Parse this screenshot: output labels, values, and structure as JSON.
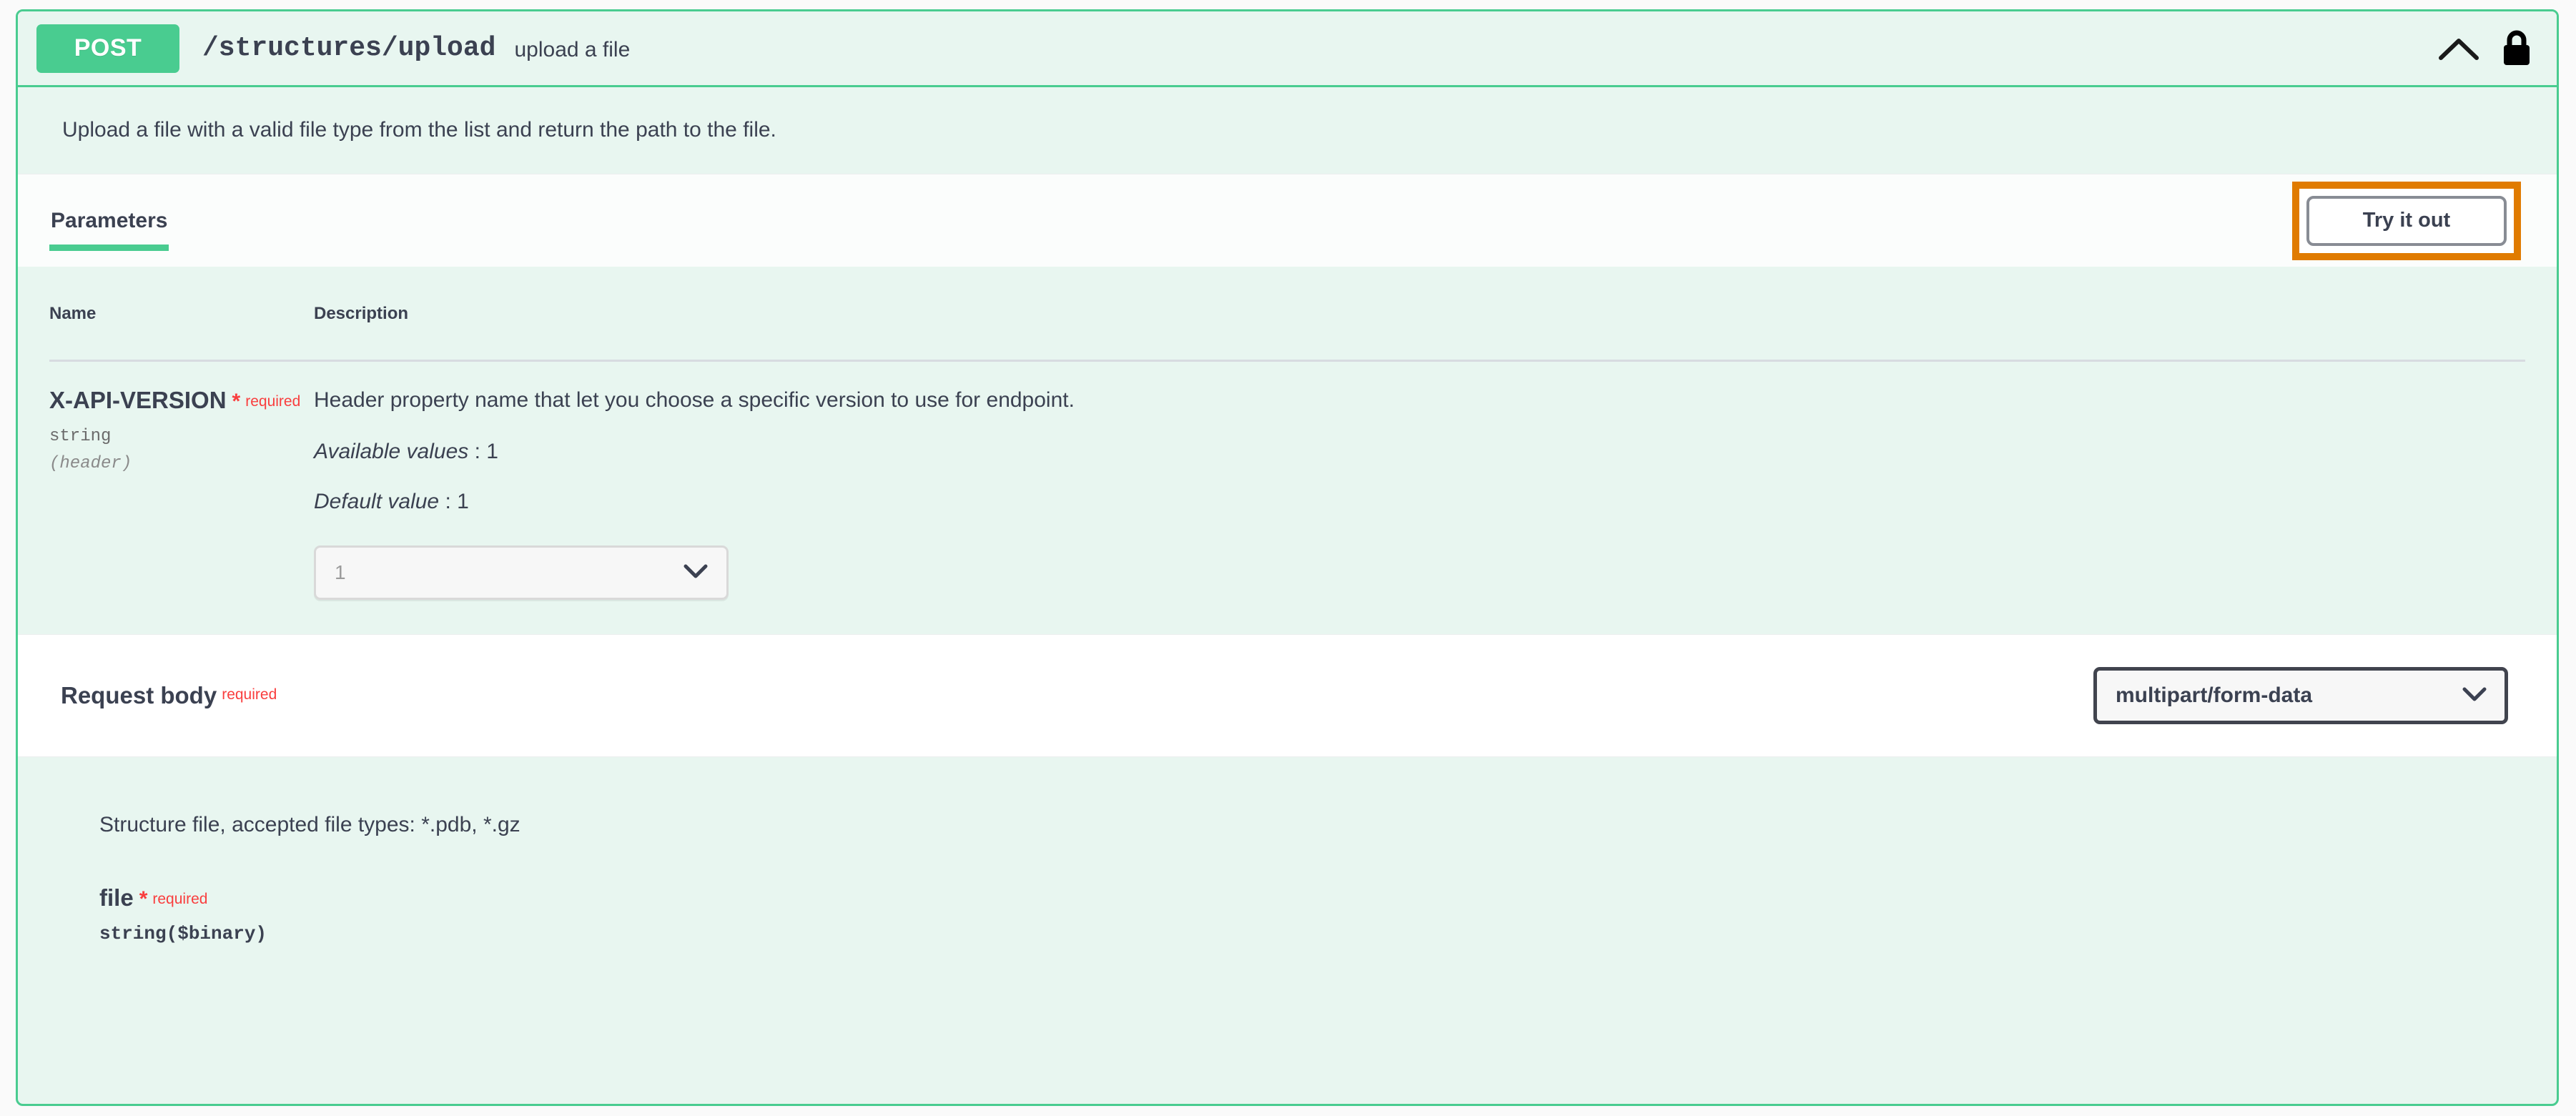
{
  "operation": {
    "method": "POST",
    "path": "/structures/upload",
    "summary": "upload a file",
    "description": "Upload a file with a valid file type from the list and return the path to the file.",
    "collapse_icon": "chevron-up-icon",
    "auth_icon": "lock-icon",
    "accent_color": "#49cc90",
    "required_color": "#f93e3e",
    "highlight_color": "#e07b00"
  },
  "tabs": [
    {
      "label": "Parameters",
      "active": true
    }
  ],
  "actions": {
    "try_it_out_label": "Try it out"
  },
  "parameters_table": {
    "headers": [
      "Name",
      "Description"
    ],
    "rows": [
      {
        "name": "X-API-VERSION",
        "required_star": "*",
        "required_text": "required",
        "type": "string",
        "location": "(header)",
        "description": "Header property name that let you choose a specific version to use for endpoint.",
        "meta": [
          {
            "label": "Available values",
            "separator": " : ",
            "value": "1"
          },
          {
            "label": "Default value",
            "separator": " : ",
            "value": "1"
          }
        ],
        "input": {
          "kind": "select",
          "value": "1",
          "disabled": true,
          "icon": "chevron-down-icon"
        }
      }
    ]
  },
  "request_body": {
    "label": "Request body",
    "required_text": "required",
    "content_type": {
      "value": "multipart/form-data",
      "icon": "chevron-down-icon"
    },
    "schema": {
      "description": "Structure file, accepted file types: *.pdb, *.gz",
      "field_name": "file",
      "required_star": "*",
      "required_text": "required",
      "field_type": "string($binary)"
    }
  }
}
